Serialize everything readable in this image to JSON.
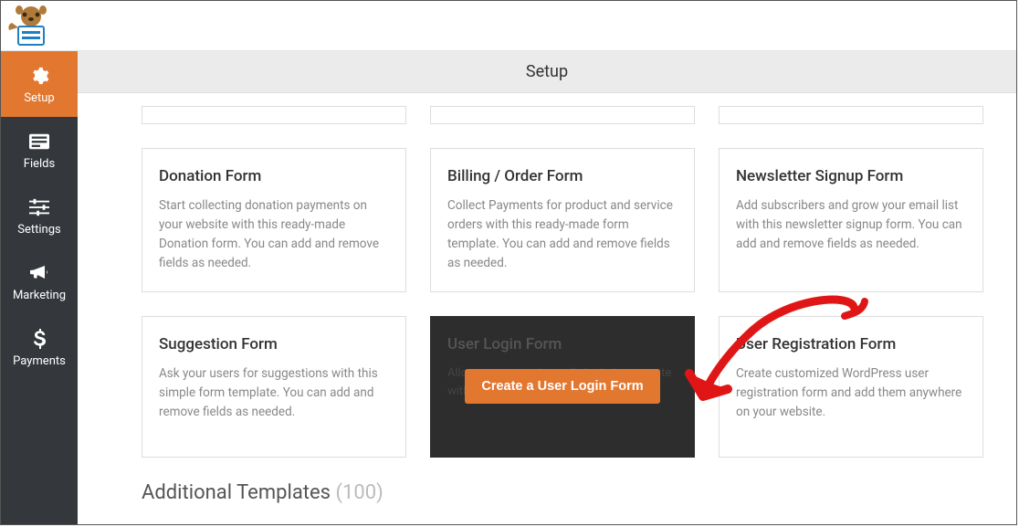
{
  "header": {
    "page_title": "Setup"
  },
  "sidebar": {
    "items": [
      {
        "label": "Setup",
        "icon": "gear-icon",
        "active": true
      },
      {
        "label": "Fields",
        "icon": "list-icon",
        "active": false
      },
      {
        "label": "Settings",
        "icon": "sliders-icon",
        "active": false
      },
      {
        "label": "Marketing",
        "icon": "bullhorn-icon",
        "active": false
      },
      {
        "label": "Payments",
        "icon": "dollar-icon",
        "active": false
      }
    ]
  },
  "templates": {
    "row1": [
      {
        "title": "Donation Form",
        "desc": "Start collecting donation payments on your website with this ready-made Donation form. You can add and remove fields as needed."
      },
      {
        "title": "Billing / Order Form",
        "desc": "Collect Payments for product and service orders with this ready-made form template. You can add and remove fields as needed."
      },
      {
        "title": "Newsletter Signup Form",
        "desc": "Add subscribers and grow your email list with this newsletter signup form. You can add and remove fields as needed."
      }
    ],
    "row2": [
      {
        "title": "Suggestion Form",
        "desc": "Ask your users for suggestions with this simple form template. You can add and remove fields as needed."
      },
      {
        "title": "User Login Form",
        "desc": "Allow your users to easily login to your site with their username and password.",
        "cta": "Create a User Login Form",
        "highlighted": true
      },
      {
        "title": "User Registration Form",
        "desc": "Create customized WordPress user registration form and add them anywhere on your website."
      }
    ]
  },
  "additional_section": {
    "label": "Additional Templates",
    "count": "(100)"
  }
}
